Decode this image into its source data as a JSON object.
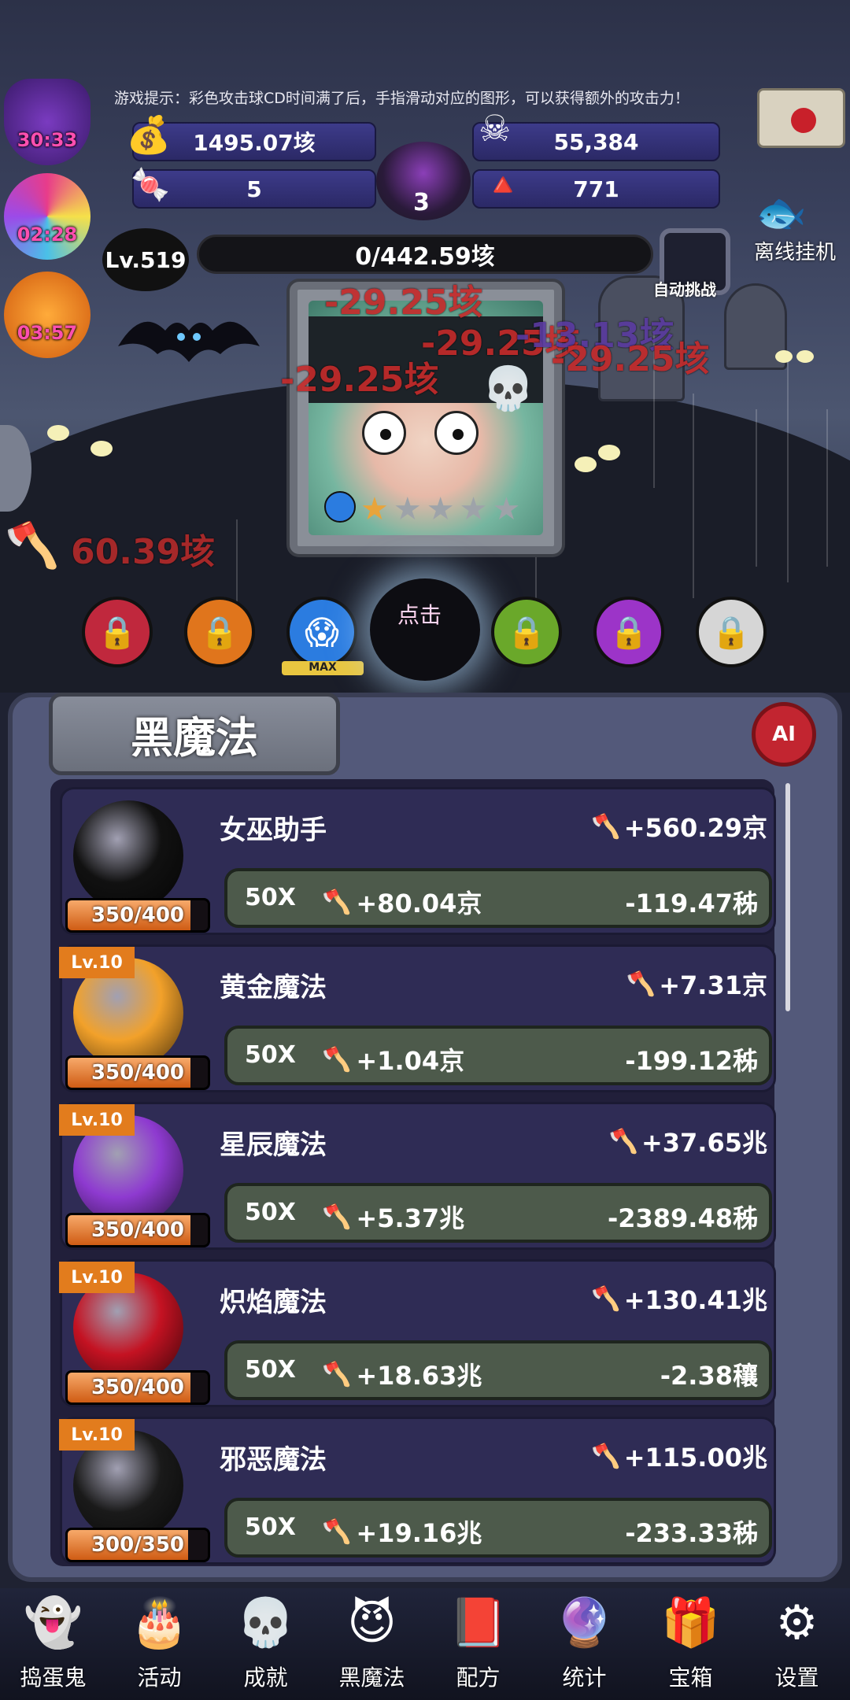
{
  "hint": "游戏提示：彩色攻击球CD时间满了后，手指滑动对应的图形，可以获得额外的攻击力！",
  "timers": [
    {
      "value": "30:33",
      "icon": "witch-hat-icon"
    },
    {
      "value": "02:28",
      "icon": "candy-swirl-icon"
    },
    {
      "value": "03:57",
      "icon": "pumpkin-icon"
    }
  ],
  "resources": {
    "gold": "1495.07垓",
    "souls": "55,384",
    "candy": "5",
    "cauldron": "3",
    "candycorn": "771"
  },
  "level": {
    "badge": "Lv.519",
    "progress": "0/442.59垓",
    "auto_label": "自动挑战",
    "offline_label": "离线挂机"
  },
  "damage_popups": [
    "-29.25垓",
    "-29.25垓",
    "-13.13垓",
    "-29.25垓",
    "-29.25垓"
  ],
  "side_attack": "60.39垓",
  "orbs": {
    "max_label": "MAX",
    "click_label": "点击",
    "colors": [
      "#c0283d",
      "#e0751c",
      "#2b7ce0",
      "#6aa82a",
      "#9c34c8",
      "#d6d6d6"
    ]
  },
  "panel": {
    "title": "黑魔法",
    "ai_label": "AI"
  },
  "rows": [
    {
      "name": "女巫助手",
      "bonus": "+560.29京",
      "level": "",
      "progress": "350/400",
      "fill": 0.875,
      "multi": "50X",
      "inc": "+80.04京",
      "cost": "-119.47秭",
      "color": "#111111"
    },
    {
      "name": "黄金魔法",
      "bonus": "+7.31京",
      "level": "Lv.10",
      "progress": "350/400",
      "fill": 0.875,
      "multi": "50X",
      "inc": "+1.04京",
      "cost": "-199.12秭",
      "color": "#f2a12a"
    },
    {
      "name": "星辰魔法",
      "bonus": "+37.65兆",
      "level": "Lv.10",
      "progress": "350/400",
      "fill": 0.875,
      "multi": "50X",
      "inc": "+5.37兆",
      "cost": "-2389.48秭",
      "color": "#8e3ad0"
    },
    {
      "name": "炽焰魔法",
      "bonus": "+130.41兆",
      "level": "Lv.10",
      "progress": "350/400",
      "fill": 0.875,
      "multi": "50X",
      "inc": "+18.63兆",
      "cost": "-2.38穰",
      "color": "#c41222"
    },
    {
      "name": "邪恶魔法",
      "bonus": "+115.00兆",
      "level": "Lv.10",
      "progress": "300/350",
      "fill": 0.857,
      "multi": "50X",
      "inc": "+19.16兆",
      "cost": "-233.33秭",
      "color": "#1a1a1a"
    }
  ],
  "nav": [
    {
      "label": "捣蛋鬼",
      "icon": "ghost-icon"
    },
    {
      "label": "活动",
      "icon": "cake-icon"
    },
    {
      "label": "成就",
      "icon": "skull-icon"
    },
    {
      "label": "黑魔法",
      "icon": "demon-icon"
    },
    {
      "label": "配方",
      "icon": "book-icon"
    },
    {
      "label": "统计",
      "icon": "crystal-ball-icon"
    },
    {
      "label": "宝箱",
      "icon": "gift-icon"
    },
    {
      "label": "设置",
      "icon": "gear-icon"
    }
  ]
}
